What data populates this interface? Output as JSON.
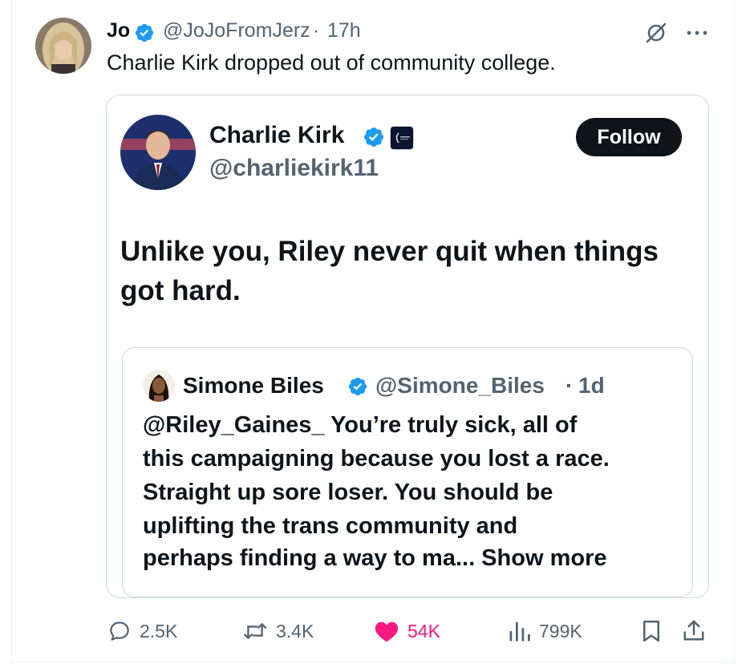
{
  "post": {
    "author_name": "Jo",
    "author_handle": "@JoJoFromJerz",
    "separator": "·",
    "time": "17h",
    "text": "Charlie Kirk dropped out of community college.",
    "more_icon": "ellipsis-icon",
    "grok_icon": "grok-icon"
  },
  "quoted": {
    "author_name": "Charlie Kirk",
    "author_handle": "@charliekirk11",
    "follow_label": "Follow",
    "text_line1": "Unlike you, Riley never quit when things",
    "text_line2": "got hard."
  },
  "nested": {
    "author_name": "Simone Biles",
    "author_handle": "@Simone_Biles",
    "separator": "·",
    "time": "1d",
    "lines": [
      "@Riley_Gaines_ You’re truly sick, all of",
      "this campaigning because you lost a race.",
      "Straight up sore loser. You should be",
      "uplifting the trans community and",
      "perhaps finding a way to ma... Show more"
    ]
  },
  "actions": {
    "replies": "2.5K",
    "reposts": "3.4K",
    "likes": "54K",
    "views": "799K"
  },
  "colors": {
    "verified": "#1d9bf0",
    "like": "#f91880",
    "muted": "#536471",
    "border": "#cfd9de"
  }
}
